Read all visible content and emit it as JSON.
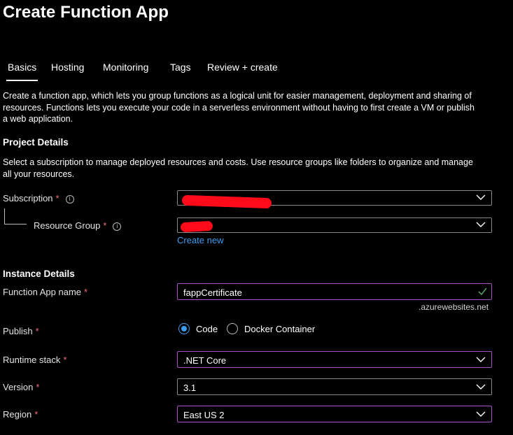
{
  "page": {
    "title": "Create Function App"
  },
  "tabs": [
    {
      "label": "Basics"
    },
    {
      "label": "Hosting"
    },
    {
      "label": "Monitoring"
    },
    {
      "label": "Tags"
    },
    {
      "label": "Review + create"
    }
  ],
  "intro": {
    "line1": "Create a function app, which lets you group functions as a logical unit for easier management, deployment and sharing of",
    "line2": "resources. Functions lets you execute your code in a serverless environment without having to first create a VM or publish",
    "line3": "a web application."
  },
  "project": {
    "heading": "Project Details",
    "desc_line1": "Select a subscription to manage deployed resources and costs. Use resource groups like folders to organize and manage",
    "desc_line2": "all your resources.",
    "subscription_label": "Subscription",
    "resource_group_label": "Resource Group",
    "create_new": "Create new"
  },
  "instance": {
    "heading": "Instance Details",
    "name_label": "Function App name",
    "name_value": "fappCertificate",
    "name_suffix": ".azurewebsites.net",
    "publish_label": "Publish",
    "publish_options": [
      "Code",
      "Docker Container"
    ],
    "publish_selected": "Code",
    "runtime_label": "Runtime stack",
    "runtime_value": ".NET Core",
    "version_label": "Version",
    "version_value": "3.1",
    "region_label": "Region",
    "region_value": "East US 2"
  },
  "required_mark": "*",
  "info_glyph": "i",
  "colors": {
    "background": "#000000",
    "link": "#3a9df2",
    "required": "#f1707b",
    "valid_check": "#5fb56b",
    "highlight_border": "#a64fc1",
    "redaction": "#ff0a18"
  }
}
